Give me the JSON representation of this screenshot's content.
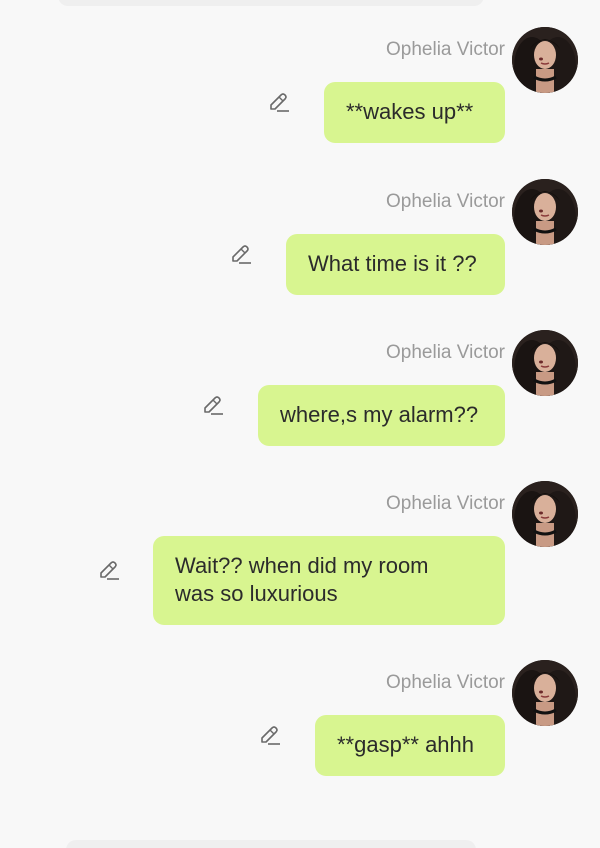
{
  "messages": [
    {
      "sender": "Ophelia Victor",
      "text": "**wakes up**",
      "edit_icon": "pencil-icon"
    },
    {
      "sender": "Ophelia Victor",
      "text": "What time is it ??",
      "edit_icon": "pencil-icon"
    },
    {
      "sender": "Ophelia Victor",
      "text": "where,s my alarm??",
      "edit_icon": "pencil-icon"
    },
    {
      "sender": "Ophelia Victor",
      "text": "Wait?? when did my room\nwas so luxurious",
      "edit_icon": "pencil-icon"
    },
    {
      "sender": "Ophelia Victor",
      "text": "**gasp** ahhh",
      "edit_icon": "pencil-icon"
    }
  ],
  "colors": {
    "background": "#f8f8f8",
    "bubble": "#d8f590",
    "sender_text": "#9a9a9a",
    "message_text": "#2b2b2b"
  }
}
